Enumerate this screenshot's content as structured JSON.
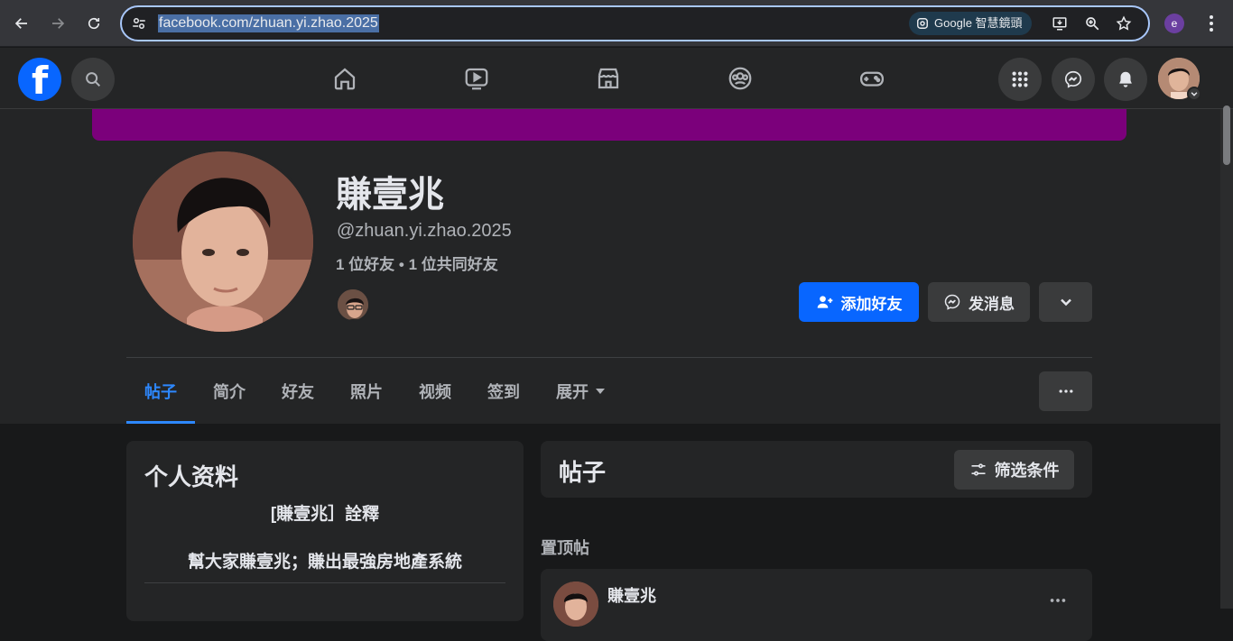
{
  "browser": {
    "url": "facebook.com/zhuan.yi.zhao.2025",
    "lens_label": "Google 智慧鏡頭",
    "profile_initial": "e"
  },
  "fb_nav": {
    "icons": [
      "home-icon",
      "video-icon",
      "marketplace-icon",
      "groups-icon",
      "gaming-icon"
    ],
    "right_icons": [
      "menu-grid-icon",
      "messenger-icon",
      "notifications-icon"
    ]
  },
  "profile": {
    "name": "賺壹兆",
    "handle": "@zhuan.yi.zhao.2025",
    "friends": "1 位好友 • 1 位共同好友",
    "add_friend_label": "添加好友",
    "message_label": "发消息",
    "cover_color": "#7b007b"
  },
  "tabs": [
    {
      "label": "帖子",
      "active": true
    },
    {
      "label": "简介",
      "active": false
    },
    {
      "label": "好友",
      "active": false
    },
    {
      "label": "照片",
      "active": false
    },
    {
      "label": "视频",
      "active": false
    },
    {
      "label": "签到",
      "active": false
    },
    {
      "label": "展开",
      "active": false
    }
  ],
  "intro": {
    "title": "个人资料",
    "line1": "[賺壹兆］詮釋",
    "line2": "幫大家賺壹兆；賺出最強房地產系統"
  },
  "posts": {
    "title": "帖子",
    "filter_label": "筛选条件",
    "pinned_label": "置顶帖",
    "first_post_author": "賺壹兆"
  },
  "colors": {
    "accent": "#0866ff",
    "active_tab": "#2d88ff",
    "background": "#18191a",
    "surface": "#242526"
  }
}
